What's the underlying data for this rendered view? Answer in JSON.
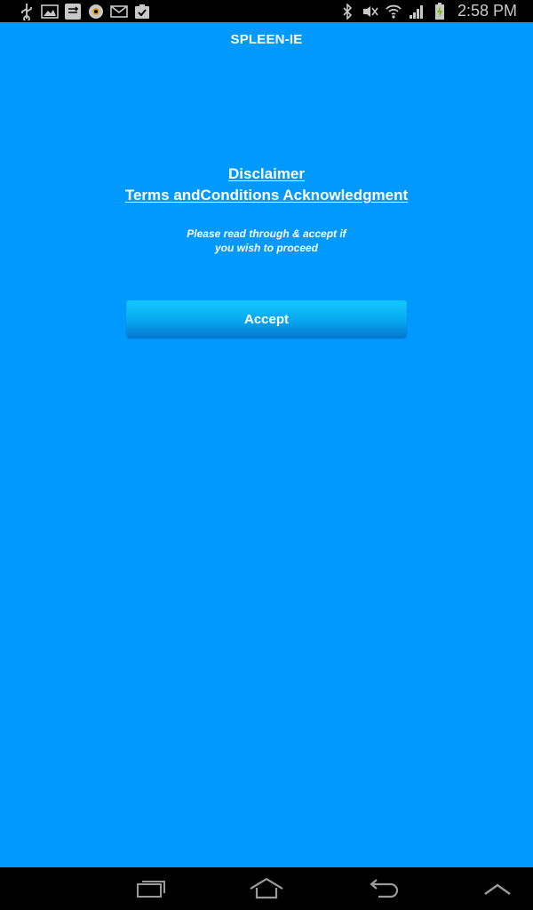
{
  "status_bar": {
    "time": "2:58 PM",
    "left_icons": [
      "usb-icon",
      "gallery-icon",
      "screen-mirror-icon",
      "app-notification-icon",
      "mail-icon",
      "task-icon"
    ],
    "right_icons": [
      "bluetooth-icon",
      "mute-icon",
      "wifi-icon",
      "signal-icon",
      "battery-charging-icon"
    ]
  },
  "app": {
    "title": "SPLEEN-IE"
  },
  "disclaimer": {
    "line1": "Disclaimer",
    "line2": "Terms andConditions Acknowledgment"
  },
  "instruction": {
    "line1": "Please read through & accept if",
    "line2": "you wish to proceed"
  },
  "accept_button": {
    "label": "Accept"
  },
  "nav_bar": {
    "buttons": [
      "recent-apps-icon",
      "home-icon",
      "back-icon",
      "menu-up-icon"
    ]
  },
  "colors": {
    "background": "#0099ff",
    "button_top": "#12c8ff",
    "button_bottom": "#0478cf",
    "bars": "#000000"
  }
}
